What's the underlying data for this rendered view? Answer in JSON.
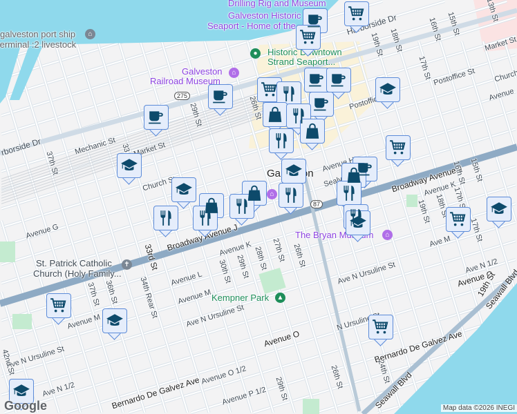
{
  "labels": {
    "drilling_rig": "Drilling Rig and Museum",
    "seaport_1": "Galveston Historic",
    "seaport_2": "Seaport - Home of the...",
    "port_1": "galveston port ship",
    "port_2": "terminal :2 livestock",
    "strand_1": "Historic Downtown",
    "strand_2": "Strand Seaport...",
    "railroad_1": "Galveston",
    "railroad_2": "Railroad Museum",
    "harborside_right": "Harborside Dr",
    "harborside_left": "rborside Dr",
    "mechanic": "Mechanic St",
    "market_left": "Market St",
    "church_left": "Church St",
    "market_right": "Market St",
    "church_right": "Church St",
    "postoffice_right": "Postoffice St",
    "postoffice_mid": "Postoffic",
    "avenue_h": "Avenue H",
    "sealy": "Sealy",
    "city": "Galveston",
    "broadway_left": "Broadway Avenue J",
    "broadway_right": "Broadway Avenue J",
    "avenue_k_left": "Avenue K",
    "avenue_k_right": "Avenue K",
    "avenue_g": "Avenue G",
    "avenue_l": "Avenue L",
    "avenue_m": "Avenue M",
    "avenue_m_left": "Avenue M",
    "avenue_m_right": "Ave M",
    "ave_n_ursuline_mid": "Ave N Ursuline St",
    "ave_n_ursuline_left": "Ave N Ursuline St",
    "ave_n_ursuline_right": "Ave N Ursuline St",
    "ave_n_ursuline_far": "N Ursuline St",
    "avenue_o_mid": "Avenue O",
    "avenue_o_right": "Avenue O",
    "avenue_o_half": "Avenue O 1/2",
    "ave_n_half_right": "Ave N 1/2",
    "ave_n_half_left": "Ave N 1/2",
    "avenue_p_half": "Avenue P 1/2",
    "bernardo_right": "Bernardo De Galvez Ave",
    "bernardo_left": "Bernardo De Galvez Ave",
    "seawall_1": "Seawall Blvd",
    "seawall_2": "Seawall Blvd",
    "kempner": "Kempner Park",
    "bryan": "The Bryan Museum",
    "stpatrick_1": "St. Patrick Catholic",
    "stpatrick_2": "Church (Holy Family...",
    "st_37_top": "37th St",
    "st_33_top": "33",
    "st_29_top": "29th St",
    "st_26_top": "26th St",
    "st_19_top": "19th St",
    "st_18_top": "18th St",
    "st_17_top": "17th St",
    "st_16_top": "16th St",
    "st_15_top": "15th St",
    "st_13_top": "13th St",
    "st_16_mid": "16th St",
    "st_15_mid": "15th St",
    "st_17_mid": "17th St",
    "st_18_mid": "18th St",
    "st_19_mid": "19th St",
    "st_33_mid": "33rd St",
    "st_34_rear": "34th Rear St",
    "st_36": "36th St",
    "st_37_low": "37th St",
    "st_42": "42nd St",
    "st_30": "30th St",
    "st_29_mid": "29th St",
    "st_28": "28th St",
    "st_27": "27th St",
    "st_26_mid": "26th St",
    "st_29_low": "29th St",
    "st_26_low": "26th St",
    "st_24": "24th St",
    "st_19_low": "19th St",
    "st_17_low": "17th St",
    "avenue_right": "Avenue",
    "route_275": "275",
    "route_87": "87"
  },
  "markers": [
    {
      "icon": "coffee-icon",
      "category": "cafe"
    },
    {
      "icon": "cart-icon",
      "category": "grocery"
    },
    {
      "icon": "cart-icon",
      "category": "grocery"
    },
    {
      "icon": "coffee-icon",
      "category": "cafe"
    },
    {
      "icon": "coffee-icon",
      "category": "cafe"
    },
    {
      "icon": "cart-icon",
      "category": "grocery"
    },
    {
      "icon": "restaurant-icon",
      "category": "restaurant"
    },
    {
      "icon": "coffee-icon",
      "category": "cafe"
    },
    {
      "icon": "coffee-icon",
      "category": "cafe"
    },
    {
      "icon": "coffee-icon",
      "category": "cafe"
    },
    {
      "icon": "bag-icon",
      "category": "shopping"
    },
    {
      "icon": "restaurant-icon",
      "category": "restaurant"
    },
    {
      "icon": "bag-icon",
      "category": "shopping"
    },
    {
      "icon": "restaurant-icon",
      "category": "restaurant"
    },
    {
      "icon": "graduation-cap-icon",
      "category": "school"
    },
    {
      "icon": "cart-icon",
      "category": "grocery"
    },
    {
      "icon": "graduation-cap-icon",
      "category": "school"
    },
    {
      "icon": "coffee-icon",
      "category": "cafe"
    },
    {
      "icon": "bag-icon",
      "category": "shopping"
    },
    {
      "icon": "graduation-cap-icon",
      "category": "school"
    },
    {
      "icon": "graduation-cap-icon",
      "category": "school"
    },
    {
      "icon": "restaurant-icon",
      "category": "restaurant"
    },
    {
      "icon": "restaurant-icon",
      "category": "restaurant"
    },
    {
      "icon": "graduation-cap-icon",
      "category": "school"
    },
    {
      "icon": "bag-icon",
      "category": "shopping"
    },
    {
      "icon": "restaurant-icon",
      "category": "restaurant"
    },
    {
      "icon": "restaurant-icon",
      "category": "restaurant"
    },
    {
      "icon": "bag-icon",
      "category": "shopping"
    },
    {
      "icon": "restaurant-icon",
      "category": "restaurant"
    },
    {
      "icon": "restaurant-icon",
      "category": "restaurant"
    },
    {
      "icon": "graduation-cap-icon",
      "category": "school"
    },
    {
      "icon": "cart-icon",
      "category": "grocery"
    },
    {
      "icon": "cart-icon",
      "category": "grocery"
    },
    {
      "icon": "graduation-cap-icon",
      "category": "school"
    },
    {
      "icon": "cart-icon",
      "category": "grocery"
    },
    {
      "icon": "graduation-cap-icon",
      "category": "school"
    }
  ],
  "footer": {
    "logo": "Google",
    "attribution": "Map data ©2026 INEGI"
  },
  "colors": {
    "water": "#8fd9ec",
    "land": "#f3f3f4",
    "park": "#c4ebd0",
    "marker_bg": "#e5edfb",
    "marker_border": "#5c8bd8",
    "marker_icon": "#0d4a6b",
    "poi_purple": "#8c42e0",
    "poi_green": "#1e8e5a"
  }
}
